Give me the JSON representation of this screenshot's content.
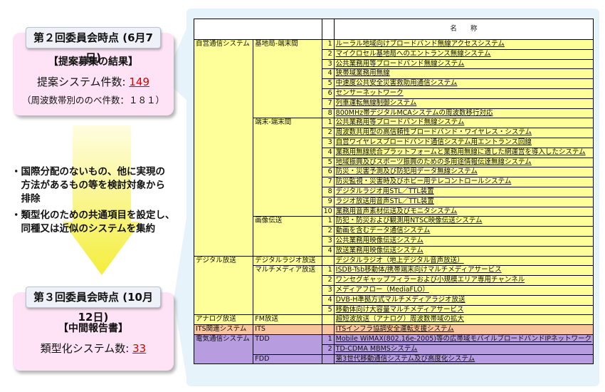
{
  "box1": {
    "title": "第２回委員会時点 (6月7日)",
    "heading": "【提案募集の結果】",
    "count_label": "提案システム件数:",
    "count_value": "149",
    "sub": "（周波数帯別ののべ件数：１８１）"
  },
  "bullets": [
    [
      "・国際分配のないもの、他に実現の",
      "　方法があるもの等を検討対象から",
      "　排除"
    ],
    [
      "・類型化のための共通項目を設定し、",
      "　同種又は近似のシステムを集約"
    ]
  ],
  "box2": {
    "title": "第３回委員会時点 (10月12日)",
    "heading": "【中間報告書】",
    "count_label": "類型化システム数:",
    "count_value": "33"
  },
  "table": {
    "header": "名　　称",
    "groups": [
      {
        "c1": "自営通信システム",
        "c2": "基地局‐端末間",
        "bg": "yel",
        "rows": [
          [
            "1",
            "ルーラル地域向けブロードバンド無線アクセスシステム"
          ],
          [
            "2",
            "マイクロセル基地局へのエントランス無線システム"
          ],
          [
            "3",
            "公共業務用等ブロードバンド無線システム"
          ],
          [
            "4",
            "狭帯域業務用無線"
          ],
          [
            "5",
            "中速度公共安全災害救助用通信システム"
          ],
          [
            "6",
            "センサーネットワーク"
          ],
          [
            "7",
            "列車運転無線制御システム"
          ],
          [
            "8",
            "800MHz帯デジタルMCAシステムの周波数移行対応"
          ]
        ]
      },
      {
        "c1": "",
        "c2": "端末‐端末間",
        "bg": "yel",
        "rows": [
          [
            "1",
            "公共業務用等ブロードバンド無線システム"
          ],
          [
            "2",
            "周波数共用型の高信頼性ブロードバンド・ワイヤレス・システム"
          ],
          [
            "3",
            "自営ワイヤレスブロードバンド通信システム用エントランス回線"
          ],
          [
            "4",
            "業務用無線統合プラットフォームと業務用無線に適した網運営を導入したシステム"
          ],
          [
            "5",
            "地域振興及びスポーツ振興のための多用途情報伝達無線システム"
          ],
          [
            "6",
            "防災・災害予測及び防犯用データ無線システム"
          ],
          [
            "7",
            "防災監視・災害時及びホビー用テレコントロールシステム"
          ],
          [
            "8",
            "デジタルラジオ用STL／TTL装置"
          ],
          [
            "9",
            "ラジオ放送用音声STL／TTL装置"
          ],
          [
            "10",
            "業務用音声素材伝送及びモニタシステム"
          ]
        ]
      },
      {
        "c1": "",
        "c2": "画像伝送",
        "bg": "yel",
        "rows": [
          [
            "1",
            "防犯・防災および観測用NTSC映像伝送システム"
          ],
          [
            "2",
            "動画を含むデータ通信システム"
          ],
          [
            "3",
            "公共業務用映像伝送システム"
          ],
          [
            "4",
            "放送業務用映像伝送システム"
          ]
        ]
      },
      {
        "c1": "デジタル放送",
        "c2": "デジタルラジオ放送",
        "bg": "yel",
        "rows": [
          [
            "",
            "デジタルラジオ（地上デジタル音声放送）"
          ]
        ]
      },
      {
        "c1": "",
        "c2": "マルチメディア放送",
        "bg": "yel",
        "rows": [
          [
            "1",
            "ISDB-Tsb移動体/携帯端末向けマルチメディアサービス"
          ],
          [
            "2",
            "ワンセグギャップフィラーおよび小規模エリア専用チャンネル"
          ],
          [
            "3",
            "メディアフロー（MediaFLO）"
          ],
          [
            "4",
            "DVB-H準拠方式マルチメディアラジオ放送"
          ],
          [
            "5",
            "移動体向け大容量マルチメディアサービス"
          ]
        ]
      },
      {
        "c1": "アナログ放送",
        "c2": "FM放送",
        "bg": "yel",
        "rows": [
          [
            "",
            "超短波放送（アナログ）周波数帯域の拡大"
          ]
        ]
      },
      {
        "c1": "ITS関連システム",
        "c2": "ITS",
        "bg": "orange",
        "rows": [
          [
            "",
            "ITSインフラ協調安全運転支援システム"
          ]
        ]
      },
      {
        "c1": "電気通信システム",
        "c2": "TDD",
        "bg": "purple",
        "rows": [
          [
            "1",
            "Mobile WiMAX(802.16e-2005)等の広帯域モバイルブロードバンドIPネットワーク"
          ],
          [
            "2",
            "TD-CDMA MBMSシステム"
          ]
        ]
      },
      {
        "c1": "",
        "c2": "FDD",
        "bg": "purple",
        "rows": [
          [
            "",
            "第3世代移動通信システム及び高度化システム"
          ]
        ]
      }
    ]
  }
}
